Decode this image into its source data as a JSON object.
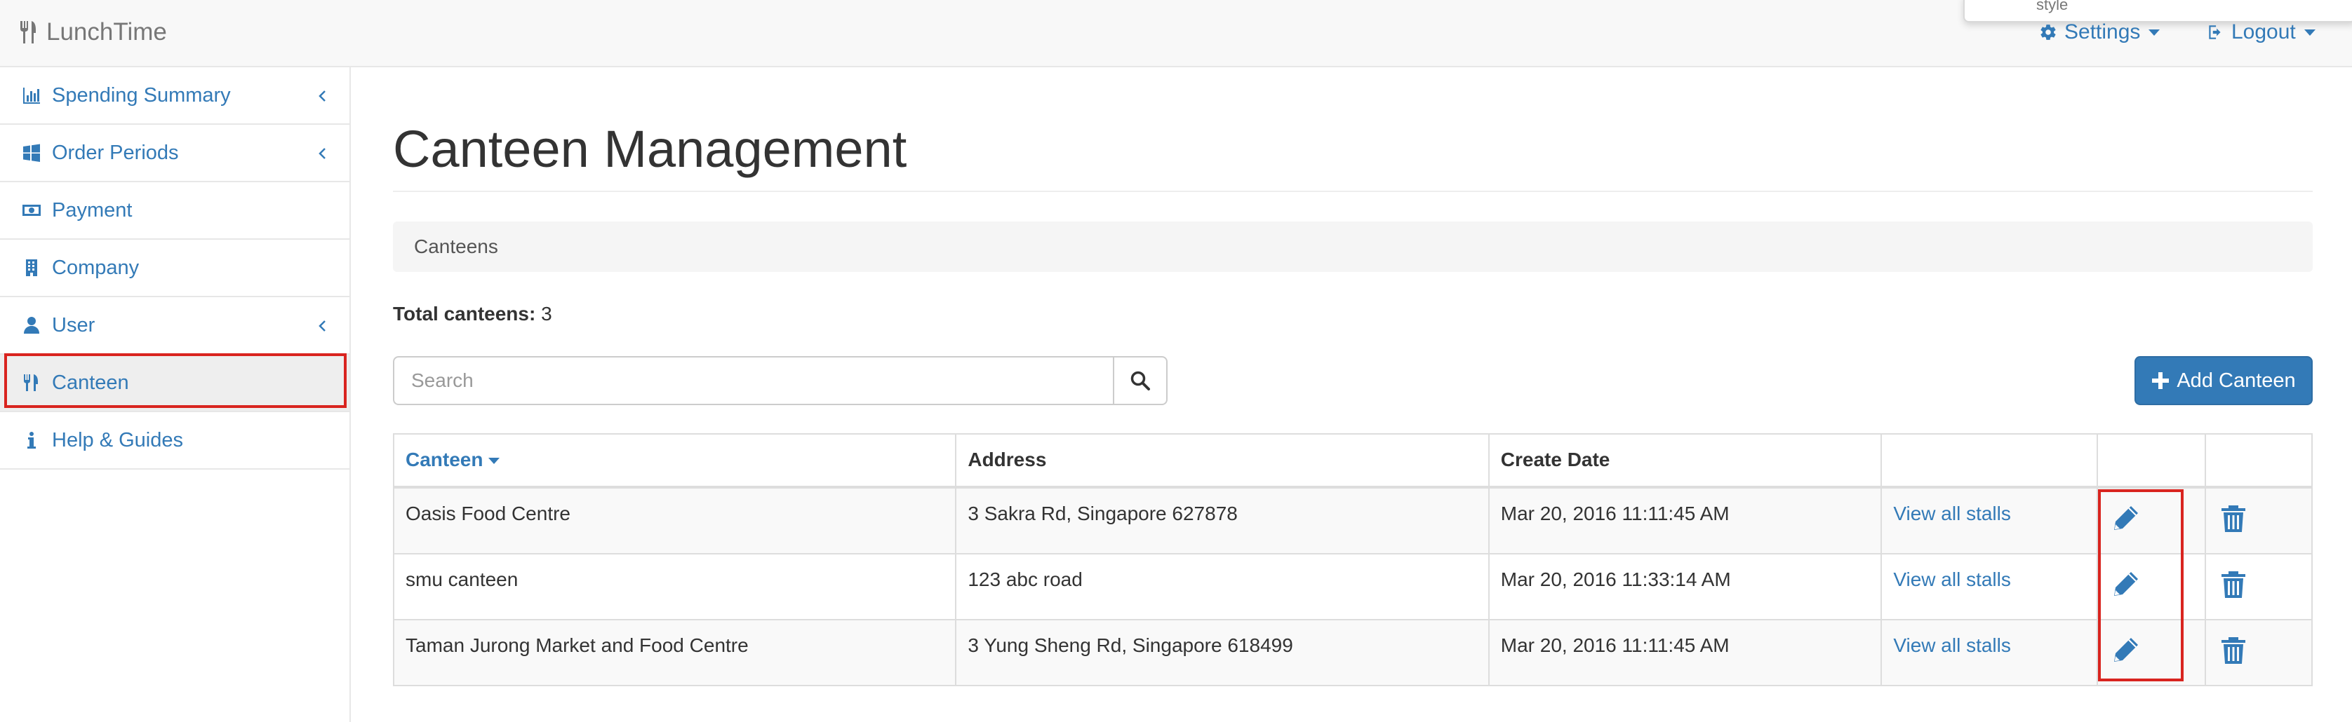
{
  "app": {
    "brand": "LunchTime",
    "popover_fragment": "style"
  },
  "navbar": {
    "settings_label": "Settings",
    "logout_label": "Logout"
  },
  "sidebar": {
    "items": [
      {
        "label": "Spending Summary",
        "icon": "bar-chart-icon",
        "has_chevron": true
      },
      {
        "label": "Order Periods",
        "icon": "windows-icon",
        "has_chevron": true
      },
      {
        "label": "Payment",
        "icon": "money-icon",
        "has_chevron": false
      },
      {
        "label": "Company",
        "icon": "building-icon",
        "has_chevron": false
      },
      {
        "label": "User",
        "icon": "user-icon",
        "has_chevron": true
      },
      {
        "label": "Canteen",
        "icon": "cutlery-icon",
        "has_chevron": false,
        "active": true
      },
      {
        "label": "Help & Guides",
        "icon": "info-icon",
        "has_chevron": false
      }
    ]
  },
  "main": {
    "title": "Canteen Management",
    "breadcrumb": "Canteens",
    "total_label": "Total canteens:",
    "total_value": "3",
    "search": {
      "placeholder": "Search"
    },
    "add_button_label": "Add Canteen",
    "table": {
      "headers": {
        "canteen": "Canteen",
        "address": "Address",
        "create_date": "Create Date"
      },
      "rows": [
        {
          "canteen": "Oasis Food Centre",
          "address": "3 Sakra Rd, Singapore 627878",
          "create_date": "Mar 20, 2016 11:11:45 AM",
          "stalls_link": "View all stalls"
        },
        {
          "canteen": "smu canteen",
          "address": "123 abc road",
          "create_date": "Mar 20, 2016 11:33:14 AM",
          "stalls_link": "View all stalls"
        },
        {
          "canteen": "Taman Jurong Market and Food Centre",
          "address": "3 Yung Sheng Rd, Singapore 618499",
          "create_date": "Mar 20, 2016 11:11:45 AM",
          "stalls_link": "View all stalls"
        }
      ]
    }
  },
  "colors": {
    "link": "#337ab7",
    "highlight": "#d9241f",
    "primary_button": "#337ab7"
  }
}
